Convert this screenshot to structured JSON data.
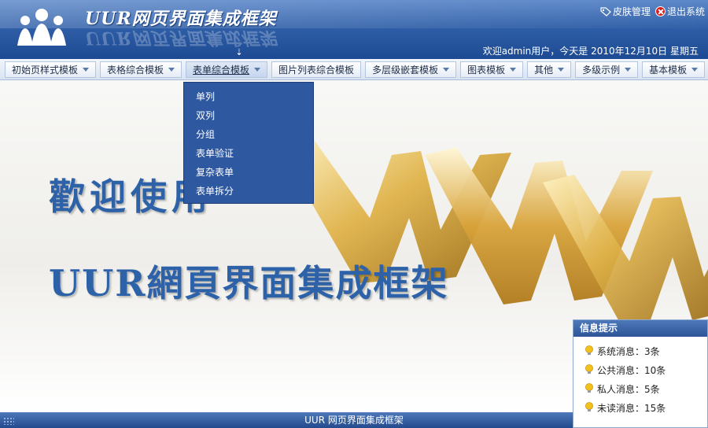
{
  "header": {
    "app_title": "UUR网页界面集成框架",
    "skin_label": "皮肤管理",
    "exit_label": "退出系统",
    "welcome_text": "欢迎admin用户，今天是 2010年12月10日 星期五"
  },
  "menu": {
    "items": [
      {
        "label": "初始页样式模板"
      },
      {
        "label": "表格综合模板"
      },
      {
        "label": "表单综合模板"
      },
      {
        "label": "图片列表综合模板"
      },
      {
        "label": "多层级嵌套模板"
      },
      {
        "label": "图表模板"
      },
      {
        "label": "其他"
      },
      {
        "label": "多级示例"
      },
      {
        "label": "基本模板"
      }
    ]
  },
  "dropdown": {
    "items": [
      "单列",
      "双列",
      "分组",
      "表单验证",
      "复杂表单",
      "表单拆分"
    ]
  },
  "banner": {
    "line1": "歡迎使用",
    "line2": "UUR網頁界面集成框架"
  },
  "info_panel": {
    "title": "信息提示",
    "rows": [
      {
        "label": "系统消息：3条"
      },
      {
        "label": "公共消息：10条"
      },
      {
        "label": "私人消息：5条"
      },
      {
        "label": "未读消息：15条"
      }
    ]
  },
  "footer": {
    "text": "UUR 网页界面集成框架"
  },
  "colors": {
    "header_blue": "#2f5fa8",
    "dropdown_blue": "#2e58a0",
    "banner_text": "#2e62a8"
  }
}
